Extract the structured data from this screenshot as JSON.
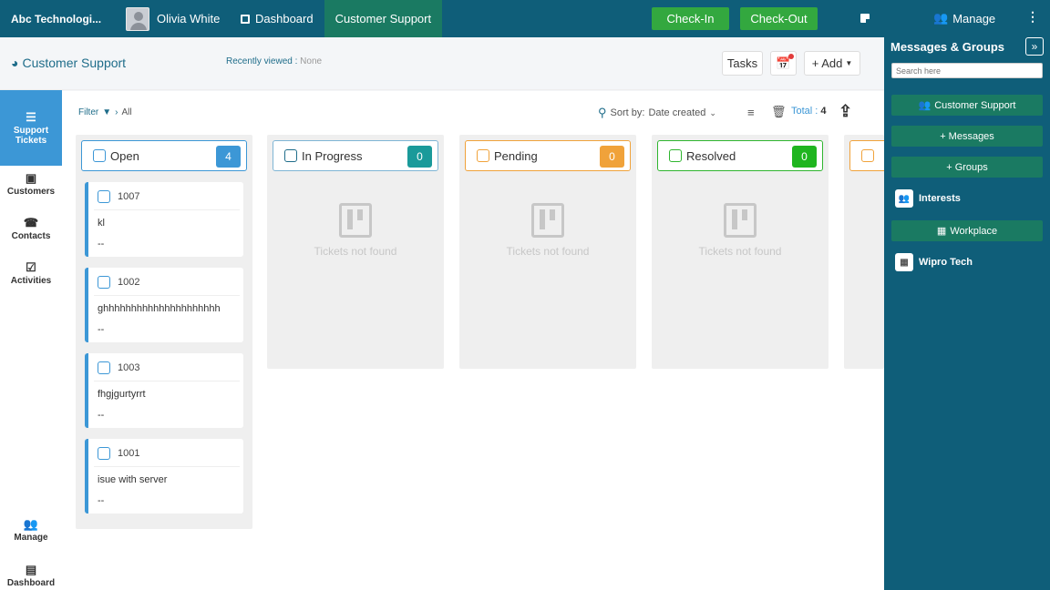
{
  "topbar": {
    "company": "Abc Technologi...",
    "user_name": "Olivia White",
    "nav": [
      {
        "label": "Dashboard",
        "active": false
      },
      {
        "label": "Customer Support",
        "active": true
      }
    ],
    "check_in": "Check-In",
    "check_out": "Check-Out"
  },
  "right_panel": {
    "manage": "Manage",
    "title": "Messages & Groups",
    "search_placeholder": "Search here",
    "buttons": {
      "customer_support": "Customer Support",
      "messages": "+ Messages",
      "groups": "+ Groups",
      "workplace": "Workplace"
    },
    "items": {
      "interests": "Interests",
      "wipro": "Wipro Tech"
    }
  },
  "subheader": {
    "title": "Customer Support",
    "recently_label": "Recently viewed :",
    "recently_value": "None",
    "tasks": "Tasks",
    "add": "+ Add"
  },
  "left_nav": {
    "support_tickets": "Support Tickets",
    "customers": "Customers",
    "contacts": "Contacts",
    "activities": "Activities",
    "manage": "Manage",
    "dashboard": "Dashboard"
  },
  "toolbar": {
    "filter": "Filter",
    "filter_path": "All",
    "sort_label": "Sort by:",
    "sort_value": "Date created",
    "total_label": "Total :",
    "total_value": "4"
  },
  "columns": [
    {
      "title": "Open",
      "count": "4",
      "color": "#3c97d6"
    },
    {
      "title": "In Progress",
      "count": "0",
      "color": "#1a9a9a",
      "empty_text": "Tickets not found"
    },
    {
      "title": "Pending",
      "count": "0",
      "color": "#f0a23a",
      "empty_text": "Tickets not found"
    },
    {
      "title": "Resolved",
      "count": "0",
      "color": "#2fb52f",
      "empty_text": "Tickets not found"
    }
  ],
  "tickets": [
    {
      "id": "1007",
      "subject": "kl",
      "detail": "--"
    },
    {
      "id": "1002",
      "subject": "ghhhhhhhhhhhhhhhhhhhhh",
      "detail": "--"
    },
    {
      "id": "1003",
      "subject": "fhgjgurtyrrt",
      "detail": "--"
    },
    {
      "id": "1001",
      "subject": "isue with server",
      "detail": "--"
    }
  ]
}
